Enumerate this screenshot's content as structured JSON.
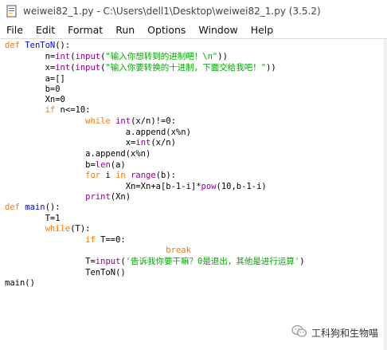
{
  "window": {
    "title": "weiwei82_1.py - C:\\Users\\dell1\\Desktop\\weiwei82_1.py (3.5.2)"
  },
  "menu": {
    "items": [
      "File",
      "Edit",
      "Format",
      "Run",
      "Options",
      "Window",
      "Help"
    ]
  },
  "code": {
    "lines": [
      [
        "def",
        " ",
        "TenToN",
        "():"
      ],
      [
        "        n=",
        "int",
        "(",
        "input",
        "(",
        "\"输入你想转到的进制吧！\\n\"",
        "))"
      ],
      [
        "        x=",
        "int",
        "(",
        "input",
        "(",
        "\"输入你要转换的十进制，下面交给我吧！\"",
        "))"
      ],
      [
        "        a=[]"
      ],
      [
        "        b=0"
      ],
      [
        "        Xn=0"
      ],
      [
        "        ",
        "if",
        " n<=10:"
      ],
      [
        "                ",
        "while",
        " ",
        "int",
        "(x/n)!=0:"
      ],
      [
        "                        a.append(x%n)"
      ],
      [
        "                        x=",
        "int",
        "(x/n)"
      ],
      [
        "                a.append(x%n)"
      ],
      [
        "                b=",
        "len",
        "(a)"
      ],
      [
        "                ",
        "for",
        " i ",
        "in",
        " ",
        "range",
        "(b):"
      ],
      [
        "                        Xn=Xn+a[b-1-i]*",
        "pow",
        "(10,b-1-i)"
      ],
      [
        "                ",
        "print",
        "(Xn)"
      ],
      [
        "def",
        " ",
        "main",
        "():"
      ],
      [
        "        T=1"
      ],
      [
        "        ",
        "while",
        "(T):"
      ],
      [
        "                ",
        "if",
        " T==0:"
      ],
      [
        "                                ",
        "break"
      ],
      [
        "                T=",
        "input",
        "(",
        "'告诉我你要干嘛？0是退出，其他是进行运算'",
        ")"
      ],
      [
        "                TenToN()"
      ],
      [
        "main()"
      ]
    ]
  },
  "watermark": {
    "text": "工科狗和生物喵",
    "icon": "wechat-icon"
  },
  "colors": {
    "keyword": "#ff7700",
    "definition": "#0000ff",
    "builtin": "#900090",
    "string": "#00aa00",
    "text": "#000000"
  }
}
